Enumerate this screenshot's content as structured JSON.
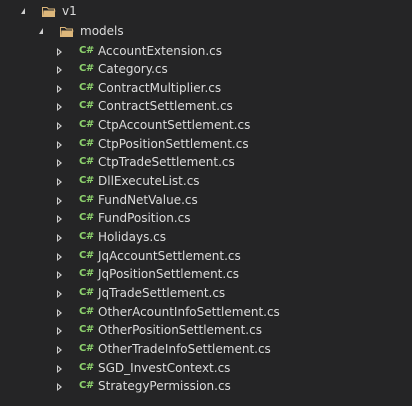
{
  "explorer": {
    "root_folder": {
      "label": "v1"
    },
    "sub_folder": {
      "label": "models"
    },
    "file_icon": {
      "glyph": "C#",
      "color": "#8ed36e"
    },
    "files": [
      "AccountExtension.cs",
      "Category.cs",
      "ContractMultiplier.cs",
      "ContractSettlement.cs",
      "CtpAccountSettlement.cs",
      "CtpPositionSettlement.cs",
      "CtpTradeSettlement.cs",
      "DllExecuteList.cs",
      "FundNetValue.cs",
      "FundPosition.cs",
      "Holidays.cs",
      "JqAccountSettlement.cs",
      "JqPositionSettlement.cs",
      "JqTradeSettlement.cs",
      "OtherAcountInfoSettlement.cs",
      "OtherPositionSettlement.cs",
      "OtherTradeInfoSettlement.cs",
      "SGD_InvestContext.cs",
      "StrategyPermission.cs"
    ]
  },
  "colors": {
    "background": "#252526",
    "text": "#dcdcdc",
    "folder": "#dcb67a",
    "arrow": "#d0d0d0"
  }
}
